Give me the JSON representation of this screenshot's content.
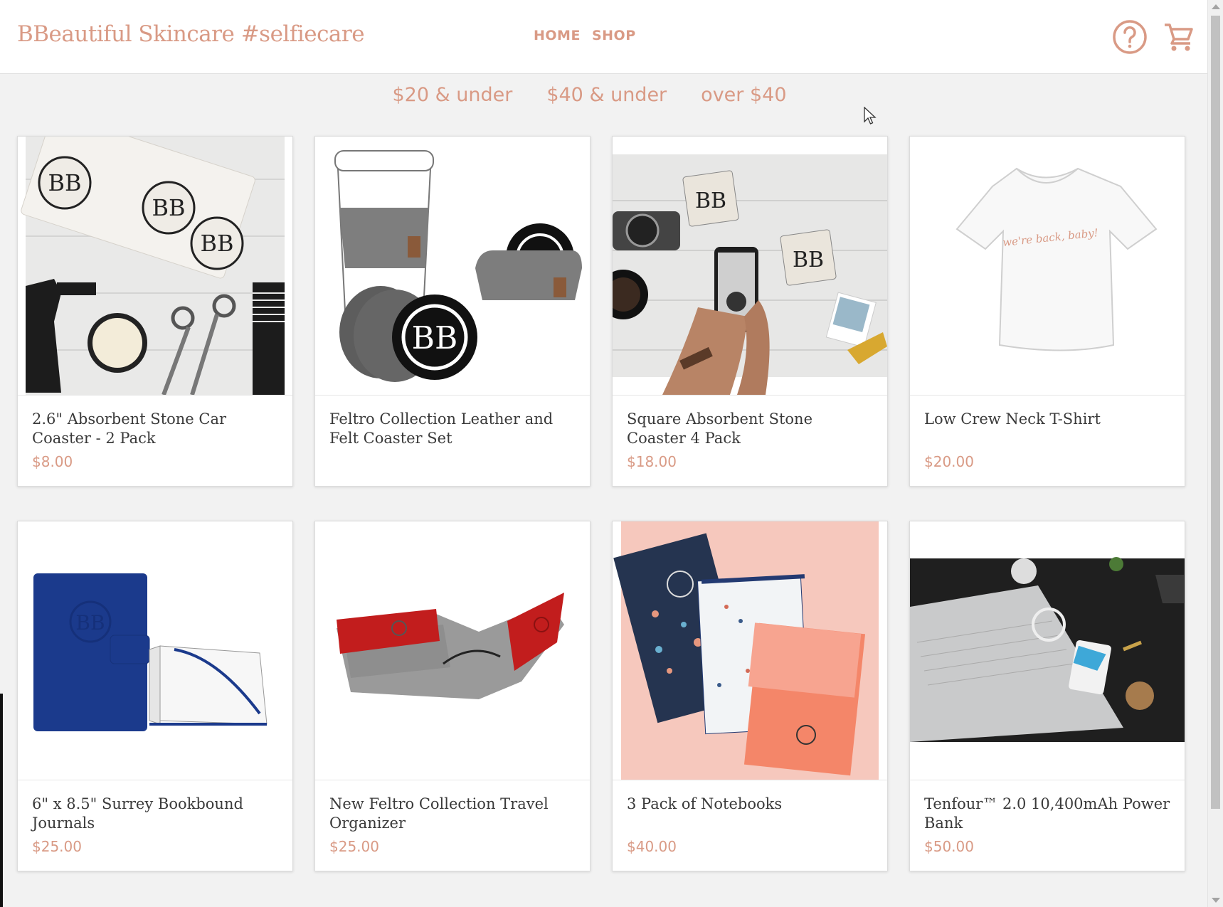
{
  "header": {
    "brand": "BBeautiful Skincare #selfiecare",
    "nav": [
      "HOME",
      "SHOP"
    ],
    "icons": [
      "help-circle-icon",
      "shopping-cart-icon"
    ]
  },
  "filters": [
    "$20 & under",
    "$40 & under",
    "over $40"
  ],
  "colors": {
    "accent": "#d99a85",
    "text": "#3a3a3a",
    "background": "#f2f2f2"
  },
  "products": [
    {
      "title": "2.6\" Absorbent Stone Car Coaster - 2 Pack",
      "price": "$8.00"
    },
    {
      "title": "Feltro Collection Leather and Felt Coaster Set",
      "price": ""
    },
    {
      "title": "Square Absorbent Stone Coaster 4 Pack",
      "price": "$18.00"
    },
    {
      "title": "Low Crew Neck T-Shirt",
      "price": "$20.00",
      "shirt_text": "we're back, baby!"
    },
    {
      "title": "6\" x 8.5\" Surrey Bookbound Journals",
      "price": "$25.00"
    },
    {
      "title": "New Feltro Collection Travel Organizer",
      "price": "$25.00"
    },
    {
      "title": "3 Pack of Notebooks",
      "price": "$40.00"
    },
    {
      "title": "Tenfour™ 2.0 10,400mAh Power Bank",
      "price": "$50.00"
    }
  ]
}
